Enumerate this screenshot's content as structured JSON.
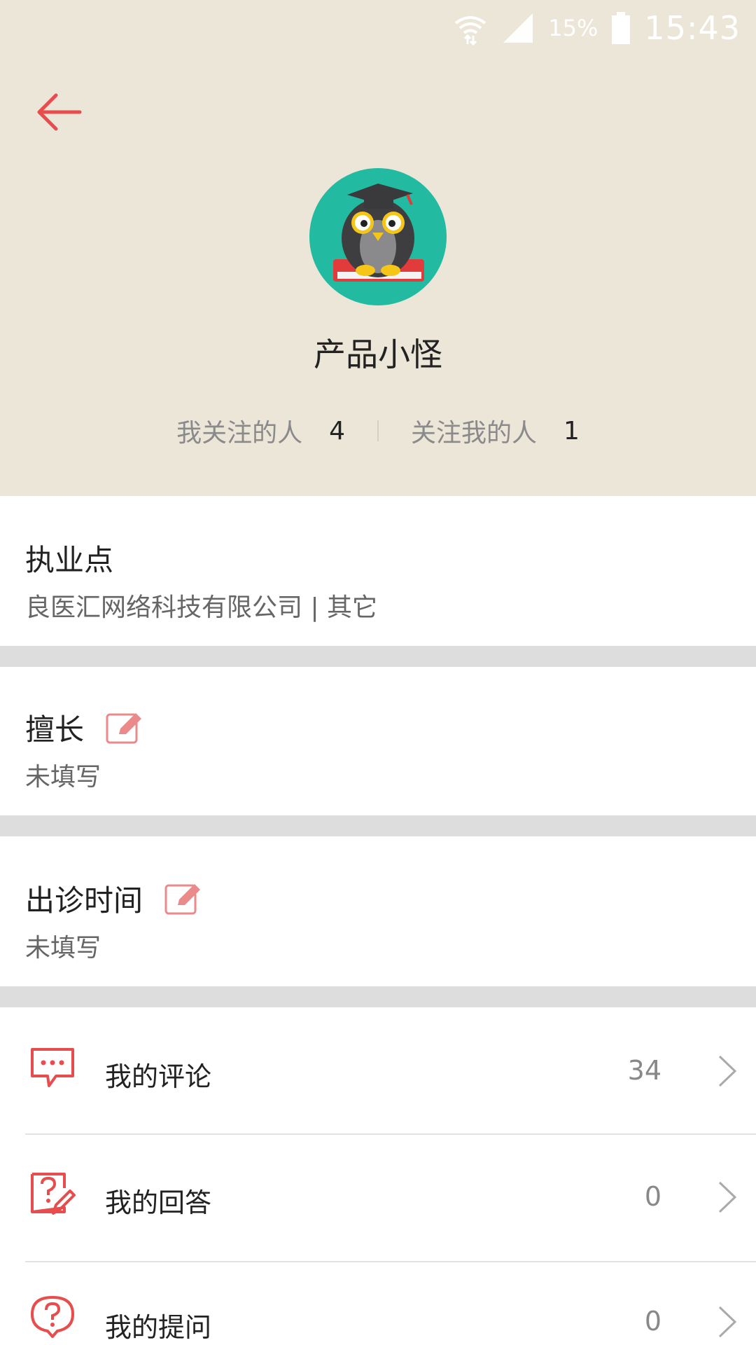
{
  "status_bar": {
    "battery_percent": "15%",
    "time": "15:43",
    "icons": [
      "wifi-icon",
      "signal-icon",
      "battery-icon"
    ]
  },
  "profile": {
    "name": "产品小怪",
    "following_label": "我关注的人",
    "following_count": "4",
    "followers_label": "关注我的人",
    "followers_count": "1"
  },
  "practice": {
    "title": "执业点",
    "value": "良医汇网络科技有限公司 | 其它"
  },
  "specialty": {
    "title": "擅长",
    "value": "未填写"
  },
  "clinic_time": {
    "title": "出诊时间",
    "value": "未填写"
  },
  "menu": [
    {
      "label": "我的评论",
      "count": "34",
      "icon": "comment-icon"
    },
    {
      "label": "我的回答",
      "count": "0",
      "icon": "answer-icon"
    },
    {
      "label": "我的提问",
      "count": "0",
      "icon": "question-icon"
    }
  ],
  "colors": {
    "header_bg": "#ebe6d8",
    "accent": "#e84d4d",
    "avatar_bg": "#22bba2",
    "gap_bg": "#dddddd"
  }
}
